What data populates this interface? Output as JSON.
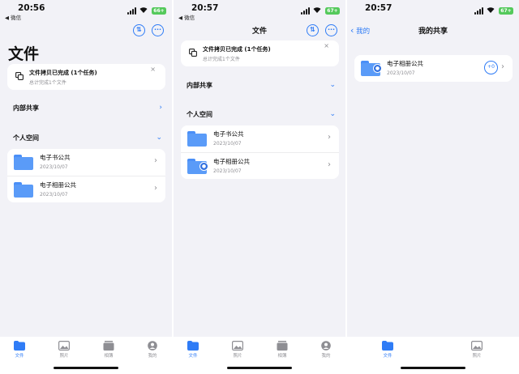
{
  "status": {
    "back_app": "◀ 微信",
    "battery_1": "66+",
    "battery_2": "67+"
  },
  "screen1": {
    "time": "20:56",
    "title": "文件",
    "toast": {
      "title": "文件拷贝已完成 (1个任务)",
      "subtitle": "总计完成1个文件",
      "close": "×"
    },
    "internal_share": "内部共享",
    "personal_space": "个人空间",
    "folders": [
      {
        "name": "电子书公共",
        "date": "2023/10/07"
      },
      {
        "name": "电子相册公共",
        "date": "2023/10/07"
      }
    ]
  },
  "screen2": {
    "time": "20:57",
    "title": "文件",
    "toast": {
      "title": "文件拷贝已完成 (1个任务)",
      "subtitle": "总计完成1个文件",
      "close": "×"
    },
    "internal_share": "内部共享",
    "personal_space": "个人空间",
    "folders": [
      {
        "name": "电子书公共",
        "date": "2023/10/07"
      },
      {
        "name": "电子相册公共",
        "date": "2023/10/07"
      }
    ]
  },
  "screen3": {
    "time": "20:57",
    "back_label": "我的",
    "title": "我的共享",
    "folder": {
      "name": "电子相册公共",
      "date": "2023/10/07",
      "share_count": "+0"
    }
  },
  "tabs": {
    "files": "文件",
    "photos": "照片",
    "albums": "相簿",
    "mine": "我的"
  },
  "colors": {
    "accent": "#2f7cf6",
    "folder": "#5a9bf8",
    "battery": "#54c95b",
    "background": "#f2f2f7"
  },
  "icons": {
    "sort": "arrow-up-down-icon",
    "more": "ellipsis-icon",
    "copy": "copy-icon",
    "folder": "folder-icon",
    "shared_user": "person-icon"
  }
}
